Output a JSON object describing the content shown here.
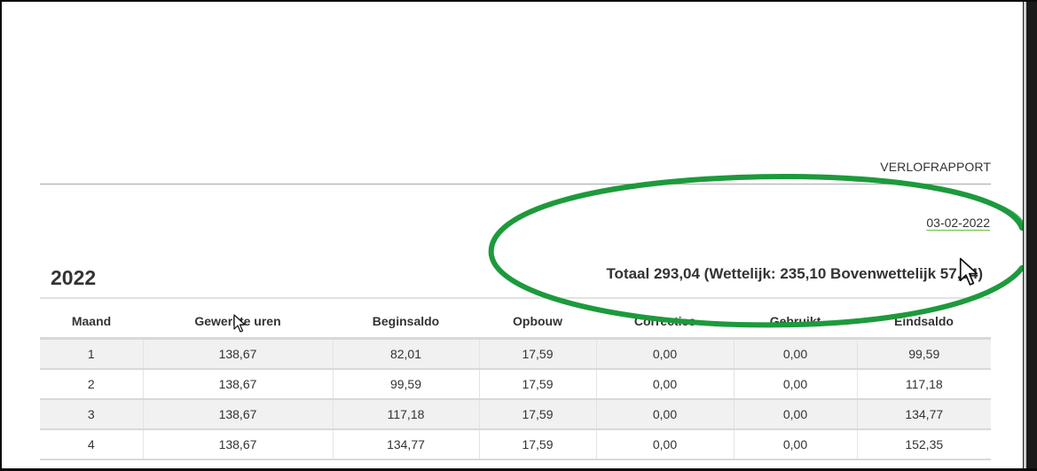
{
  "report": {
    "title": "VERLOFRAPPORT",
    "date": "03-02-2022",
    "year": "2022",
    "totaal_text": "Totaal 293,04 (Wettelijk: 235,10 Bovenwettelijk 57,94)"
  },
  "table": {
    "headers": [
      "Maand",
      "Gewerkte uren",
      "Beginsaldo",
      "Opbouw",
      "Correcties",
      "Gebruikt",
      "Eindsaldo"
    ],
    "rows": [
      [
        "1",
        "138,67",
        "82,01",
        "17,59",
        "0,00",
        "0,00",
        "99,59"
      ],
      [
        "2",
        "138,67",
        "99,59",
        "17,59",
        "0,00",
        "0,00",
        "117,18"
      ],
      [
        "3",
        "138,67",
        "117,18",
        "17,59",
        "0,00",
        "0,00",
        "134,77"
      ],
      [
        "4",
        "138,67",
        "134,77",
        "17,59",
        "0,00",
        "0,00",
        "152,35"
      ]
    ]
  },
  "colors": {
    "annotation": "#1d9a3c",
    "link_underline": "#6bbf3a",
    "text": "#333333"
  },
  "icons": {
    "mouse_cursor": "mouse-pointer-icon"
  }
}
